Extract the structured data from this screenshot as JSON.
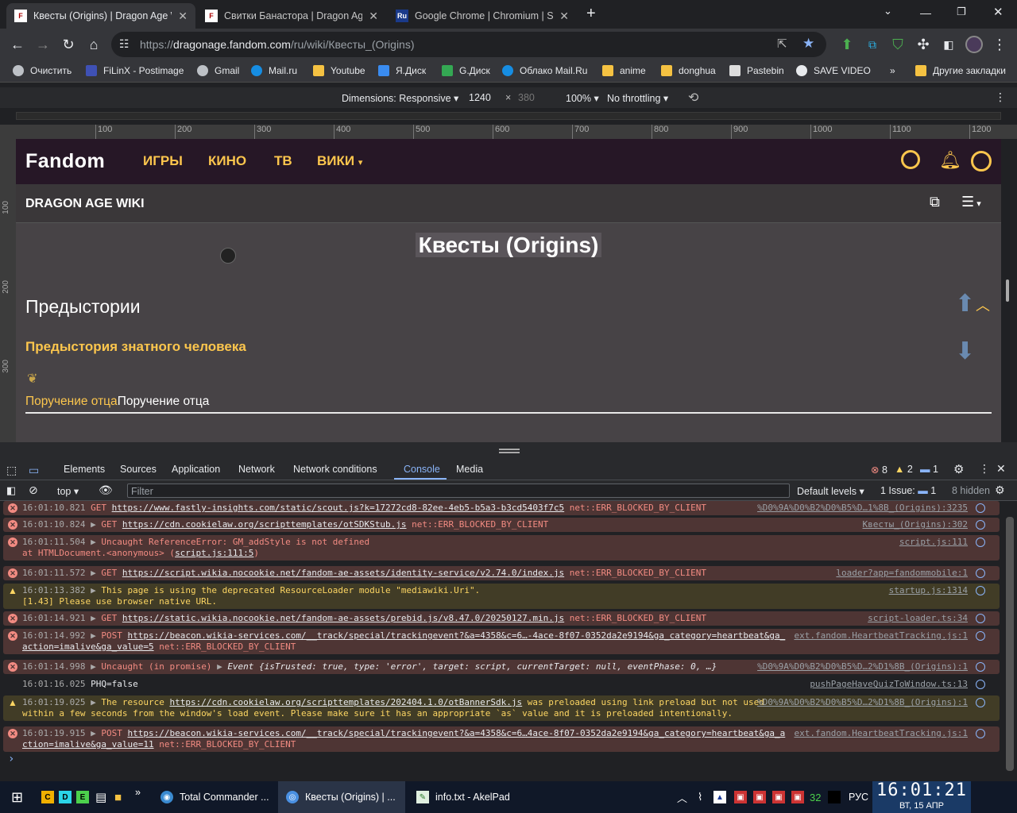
{
  "browser": {
    "tabs": [
      {
        "title": "Квесты (Origins) | Dragon Age Wiki",
        "favicon": "fandom-favicon",
        "active": true
      },
      {
        "title": "Свитки Банастора | Dragon Age Wiki",
        "favicon": "fandom-favicon",
        "active": false
      },
      {
        "title": "Google Chrome | Chromium | SRWare",
        "favicon": "ru-favicon",
        "favicon_text": "Ru",
        "active": false
      }
    ],
    "new_tab": "+",
    "url_prefix": "https://",
    "url_domain": "dragonage.fandom.com",
    "url_path": "/ru/wiki/Квесты_(Origins)",
    "extension_badge": "6",
    "bookmarks": [
      {
        "label": "Очистить",
        "icon": "gear-icon",
        "color": "#bdc1c6"
      },
      {
        "label": "FiLinX - Postimage",
        "icon": "postimage-icon",
        "color": "#3f51b5"
      },
      {
        "label": "Gmail",
        "icon": "gear-icon",
        "color": "#bdc1c6"
      },
      {
        "label": "Mail.ru",
        "icon": "mailru-icon",
        "color": "#168de2"
      },
      {
        "label": "Youtube",
        "icon": "folder-icon",
        "color": "#f5c242"
      },
      {
        "label": "Я.Диск",
        "icon": "yadisk-icon",
        "color": "#3a8cf0"
      },
      {
        "label": "G.Диск",
        "icon": "gdrive-icon",
        "color": "#34a853"
      },
      {
        "label": "Облако Mail.Ru",
        "icon": "cloud-icon",
        "color": "#168de2"
      },
      {
        "label": "anime",
        "icon": "folder-icon",
        "color": "#f5c242"
      },
      {
        "label": "donghua",
        "icon": "folder-icon",
        "color": "#f5c242"
      },
      {
        "label": "Pastebin",
        "icon": "pastebin-icon",
        "color": "#dddddd"
      },
      {
        "label": "SAVE VIDEO",
        "icon": "globe-icon",
        "color": "#e8eaed"
      }
    ],
    "bookmarks_more": "»",
    "other_bookmarks": "Другие закладки"
  },
  "device_toolbar": {
    "dimensions": "Dimensions: Responsive",
    "width": "1240",
    "times": "×",
    "height_placeholder": "380",
    "zoom": "100%",
    "throttling": "No throttling"
  },
  "rulers": {
    "h_ticks": [
      "100",
      "200",
      "300",
      "400",
      "500",
      "600",
      "700",
      "800",
      "900",
      "1000",
      "1100",
      "1200"
    ],
    "v_ticks": [
      "100",
      "200",
      "300"
    ]
  },
  "page": {
    "logo": "Fandom",
    "nav": [
      "ИГРЫ",
      "КИНО",
      "ТВ",
      "ВИКИ"
    ],
    "wiki_name": "DRAGON AGE WIKI",
    "title": "Квесты (Origins)",
    "section": "Предыстории",
    "subsection": "Предыстория знатного человека",
    "quest_link": "Поручение отца",
    "quest_text": "Поручение отца",
    "accent": "#fcc64d"
  },
  "devtools": {
    "tabs": [
      "Elements",
      "Sources",
      "Application",
      "Network",
      "Network conditions",
      "Console",
      "Media"
    ],
    "active_tab": "Console",
    "errors": "8",
    "warnings": "2",
    "issues": "1",
    "context": "top",
    "filter_placeholder": "Filter",
    "levels": "Default levels",
    "issue_label": "1 Issue:",
    "issue_count": "1",
    "hidden": "8 hidden",
    "messages": [
      {
        "type": "error",
        "time": "16:01:10.821",
        "pre": "GET ",
        "url": "https://www.fastly-insights.com/static/scout.js?k=17272cd8-82ee-4eb5-b5a3-b3cd5403f7c5",
        "post": " net::ERR_BLOCKED_BY_CLIENT",
        "src": "%D0%9A%D0%B2%D0%B5%D…1%8B_(Origins):3235"
      },
      {
        "type": "error",
        "time": "16:01:10.824",
        "pre": "GET ",
        "url": "https://cdn.cookielaw.org/scripttemplates/otSDKStub.js",
        "post": " net::ERR_BLOCKED_BY_CLIENT",
        "src": "Квесты_(Origins):302"
      },
      {
        "type": "error",
        "time": "16:01:11.504",
        "pre": "Uncaught ReferenceError: GM_addStyle is not defined",
        "line2_pre": "    at HTMLDocument.<anonymous> (",
        "line2_link": "script.js:111:5",
        "line2_post": ")",
        "src": "script.js:111"
      },
      {
        "type": "error",
        "time": "16:01:11.572",
        "pre": "GET ",
        "url": "https://script.wikia.nocookie.net/fandom-ae-assets/identity-service/v2.74.0/index.js",
        "post": " net::ERR_BLOCKED_BY_CLIENT",
        "src": "loader?app=fandommobile:1"
      },
      {
        "type": "warn",
        "time": "16:01:13.382",
        "pre": "This page is using the deprecated ResourceLoader module \"mediawiki.Uri\".",
        "line2_pre": "[1.43] Please use browser native URL.",
        "src": "startup.js:1314"
      },
      {
        "type": "error",
        "time": "16:01:14.921",
        "pre": "GET ",
        "url": "https://static.wikia.nocookie.net/fandom-ae-assets/prebid.js/v8.47.0/20250127.min.js",
        "post": " net::ERR_BLOCKED_BY_CLIENT",
        "src": "script-loader.ts:34"
      },
      {
        "type": "error",
        "time": "16:01:14.992",
        "pre": "POST ",
        "url": "https://beacon.wikia-services.com/__track/special/trackingevent?&a=4358&c=6…-4ace-8f07-0352da2e9194&ga_category=heartbeat&ga_",
        "line2_link": "action=imalive&ga_value=5",
        "line2_post": " net::ERR_BLOCKED_BY_CLIENT",
        "src": "ext.fandom.HeartbeatTracking.js:1"
      },
      {
        "type": "error",
        "time": "16:01:14.998",
        "pre": "Uncaught (in promise) ",
        "event": "Event {isTrusted: true, type: 'error', target: script, currentTarget: null, eventPhase: 0, …}",
        "src": "%D0%9A%D0%B2%D0%B5%D…2%D1%8B_(Origins):1"
      },
      {
        "type": "info",
        "time": "16:01:16.025",
        "pre": "PHQ=false",
        "src": "pushPageHaveQuizToWindow.ts:13"
      },
      {
        "type": "warn",
        "time": "16:01:19.025",
        "pre": "The resource ",
        "url": "https://cdn.cookielaw.org/scripttemplates/202404.1.0/otBannerSdk.js",
        "post": " was preloaded using link preload but not used",
        "line2_pre": "within a few seconds from the window's load event. Please make sure it has an appropriate `as` value and it is preloaded intentionally.",
        "src": "%D0%9A%D0%B2%D0%B5%D…2%D1%8B_(Origins):1"
      },
      {
        "type": "error",
        "time": "16:01:19.915",
        "pre": "POST ",
        "url": "https://beacon.wikia-services.com/__track/special/trackingevent?&a=4358&c=6…4ace-8f07-0352da2e9194&ga_category=heartbeat&ga_a",
        "line2_link": "ction=imalive&ga_value=11",
        "line2_post": " net::ERR_BLOCKED_BY_CLIENT",
        "src": "ext.fandom.HeartbeatTracking.js:1"
      }
    ],
    "prompt": "›"
  },
  "taskbar": {
    "quick": [
      {
        "label": "C",
        "color": "#f0b000"
      },
      {
        "label": "D",
        "color": "#2bd4e8"
      },
      {
        "label": "E",
        "color": "#4cd04c"
      }
    ],
    "more": "»",
    "apps": [
      {
        "label": "Total Commander ...",
        "icon": "globe-icon",
        "active": false
      },
      {
        "label": "Квесты (Origins) | ...",
        "icon": "browser-icon",
        "active": true
      },
      {
        "label": "info.txt - AkelPad",
        "icon": "notepad-icon",
        "active": false
      }
    ],
    "tray_number": "32",
    "lang": "РУС",
    "time": "16:01:21",
    "date": "ВТ, 15 АПР"
  }
}
